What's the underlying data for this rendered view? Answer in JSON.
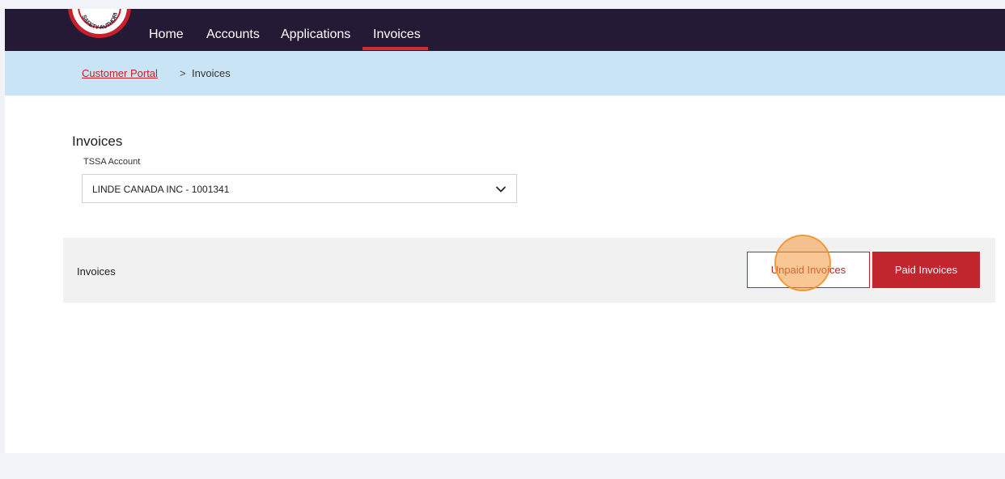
{
  "nav": {
    "items": [
      {
        "label": "Home",
        "active": false
      },
      {
        "label": "Accounts",
        "active": false
      },
      {
        "label": "Applications",
        "active": false
      },
      {
        "label": "Invoices",
        "active": true
      }
    ],
    "logo_text": "SAFETY AUTHORI"
  },
  "breadcrumb": {
    "link_label": "Customer Portal",
    "separator": ">",
    "current": "Invoices"
  },
  "page": {
    "title": "Invoices",
    "account_label": "TSSA Account",
    "account_value": "LINDE CANADA INC - 1001341"
  },
  "panel": {
    "title": "Invoices",
    "unpaid_label": "Unpaid Invoices",
    "paid_label": "Paid Invoices"
  },
  "icons": {
    "dropdown": "chevron-down-icon",
    "click": "click-indicator"
  },
  "colors": {
    "nav_bg": "#241a35",
    "accent": "#c1262e",
    "breadcrumb_bg": "#c9e4f4",
    "panel_bg": "#f1f1f1"
  }
}
